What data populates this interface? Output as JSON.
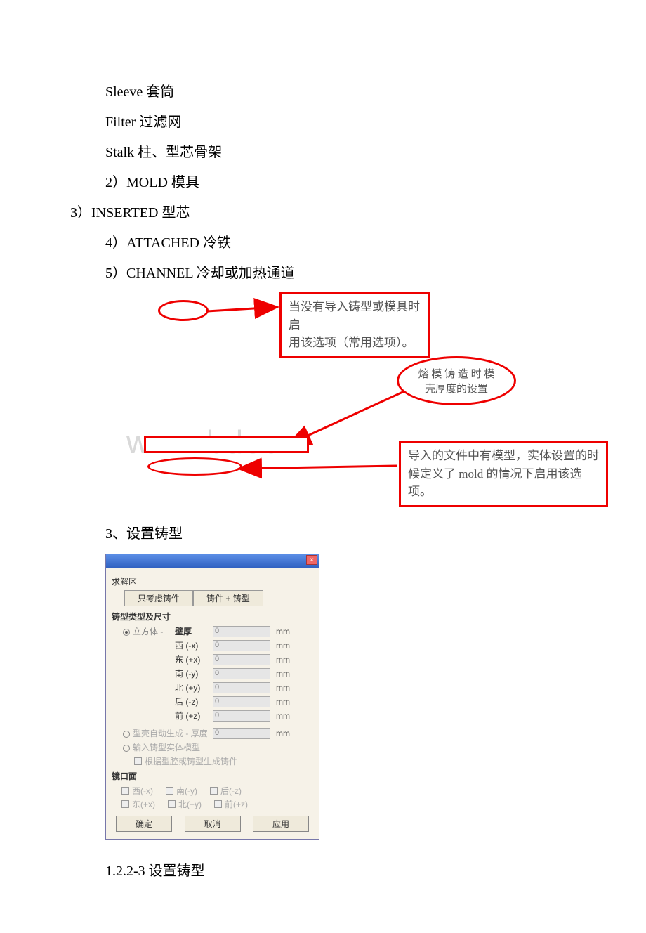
{
  "text": {
    "sleeve": "Sleeve 套筒",
    "filter": "Filter 过滤网",
    "stalk": "Stalk 柱、型芯骨架",
    "mold": "2）MOLD   模具",
    "inserted": "3）INSERTED  型芯",
    "attached": "4）ATTACHED   冷铁",
    "channel": "5）CHANNEL    冷却或加热通道",
    "section3": "3、设置铸型",
    "figcap": "1.2.2-3 设置铸型"
  },
  "annotations": {
    "a1_line1": "当没有导入铸型或模具时启",
    "a1_line2": "用该选项（常用选项）。",
    "a2_line1": "熔 模 铸 造 时 模",
    "a2_line2": "壳厚度的设置",
    "a3_line1": "导入的文件中有模型，实体设置的时",
    "a3_line2": "候定义了  mold  的情况下启用该选",
    "a3_line3": "项。"
  },
  "dialog": {
    "solve_area": "求解区",
    "tab_cast_only": "只考虑铸件",
    "tab_cast_mold": "铸件 + 铸型",
    "type_size": "铸型类型及尺寸",
    "cube": "立方体 -",
    "wall": "壁厚",
    "dir_w": "西 (-x)",
    "dir_e": "东 (+x)",
    "dir_s": "南 (-y)",
    "dir_n": "北 (+y)",
    "dir_b": "后 (-z)",
    "dir_f": "前 (+z)",
    "shell_auto": "型壳自动生成 - 厚度",
    "input_solid": "输入铸型实体模型",
    "gen_from_cavity": "根据型腔或铸型生成铸件",
    "mirror": "镜口面",
    "m_w": "西(-x)",
    "m_e": "东(+x)",
    "m_s": "南(-y)",
    "m_n": "北(+y)",
    "m_b": "后(-z)",
    "m_f": "前(+z)",
    "ok": "确定",
    "cancel": "取消",
    "apply": "应用",
    "unit": "mm",
    "val0": "0"
  },
  "watermark": "www.bdocx"
}
